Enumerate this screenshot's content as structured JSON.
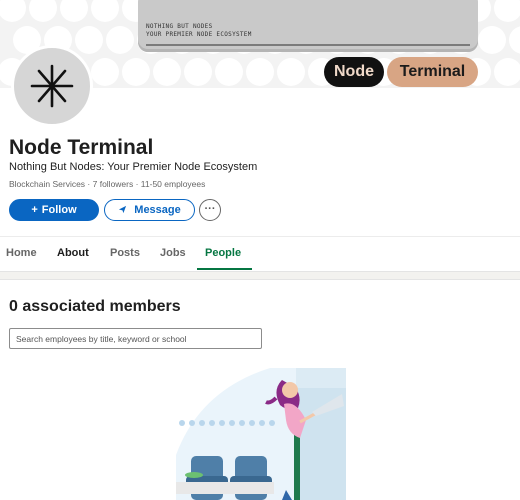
{
  "banner": {
    "screen_line1": "NOTHING BUT NODES",
    "screen_line2": "YOUR PREMIER NODE ECOSYSTEM",
    "pill_left": "Node",
    "pill_right": "Terminal"
  },
  "company": {
    "name": "Node Terminal",
    "tagline": "Nothing But Nodes: Your Premier Node Ecosystem",
    "meta": "Blockchain Services · 7 followers · 11-50 employees"
  },
  "actions": {
    "follow_label": "Follow",
    "message_label": "Message",
    "more_label": "···"
  },
  "tabs": [
    {
      "label": "Home"
    },
    {
      "label": "About"
    },
    {
      "label": "Posts"
    },
    {
      "label": "Jobs"
    },
    {
      "label": "People"
    }
  ],
  "people": {
    "title": "0 associated members",
    "search_placeholder": "Search employees by title, keyword or school"
  },
  "colors": {
    "primary": "#0a66c2",
    "active_tab": "#057642"
  }
}
